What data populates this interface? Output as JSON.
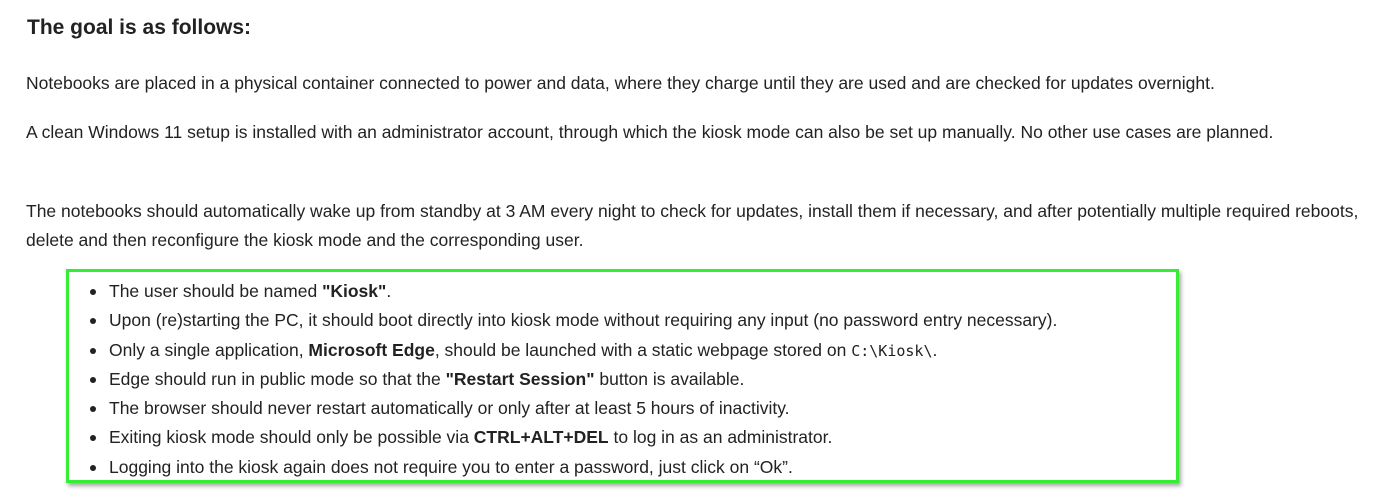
{
  "heading": "The goal is as follows:",
  "paragraphs": [
    "Notebooks are placed in a physical container connected to power and data, where they charge until they are used and are checked for updates overnight.",
    "A clean Windows 11 setup is installed with an administrator account, through which the kiosk mode can also be set up manually. No other use cases are planned.",
    "The notebooks should automatically wake up from standby at 3 AM every night to check for updates, install them if necessary, and after potentially multiple required reboots, delete and then reconfigure the kiosk mode and the corresponding user."
  ],
  "requirements": [
    {
      "before": "The user should be named ",
      "strong": "\"Kiosk\"",
      "after": "."
    },
    {
      "text": "Upon (re)starting the PC, it should boot directly into kiosk mode without requiring any input (no password entry necessary)."
    },
    {
      "before": "Only a single application, ",
      "strong": "Microsoft Edge",
      "middle": ", should be launched with a static webpage stored on ",
      "code": "C:\\Kiosk\\",
      "after": "."
    },
    {
      "before": "Edge should run in public mode so that the ",
      "strong": "\"Restart Session\"",
      "after": " button is available."
    },
    {
      "text": "The browser should never restart automatically or only after at least 5 hours of inactivity."
    },
    {
      "before": "Exiting kiosk mode should only be possible via ",
      "strong": "CTRL+ALT+DEL",
      "after": " to log in as an administrator."
    },
    {
      "text": "Logging into the kiosk again does not require you to enter a password, just click on “Ok”."
    }
  ],
  "colors": {
    "text": "#222222",
    "highlight_border": "#33ee33",
    "background": "#ffffff"
  }
}
